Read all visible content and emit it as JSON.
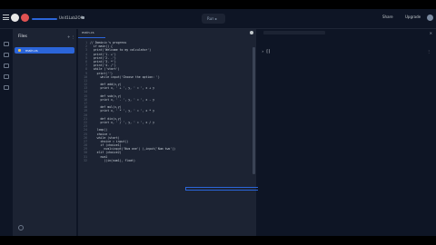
{
  "topbar": {
    "repl_name": "Unit1Lab2OK",
    "run_label": "Run ▸",
    "share_label": "Share",
    "upgrade_label": "Upgrade"
  },
  "files": {
    "title": "Files",
    "actions": "+ ⋮",
    "active_file": "main.cs"
  },
  "editor": {
    "tab_label": "main.cs",
    "lines": [
      {
        "n": "1",
        "text": "// Dominic's progress"
      },
      {
        "n": "2",
        "text": "  if main() {"
      },
      {
        "n": "3",
        "text": "  print('Welcome to my calculator')"
      },
      {
        "n": "4",
        "text": "  print('1. +')"
      },
      {
        "n": "5",
        "text": "  print('2. -')"
      },
      {
        "n": "6",
        "text": "  print('3. *')"
      },
      {
        "n": "7",
        "text": "  print('4. /')"
      },
      {
        "n": "8",
        "text": "  while ('start')"
      },
      {
        "n": "9",
        "text": "    print('')"
      },
      {
        "n": "10",
        "text": "      while input('Choose the option: ')"
      },
      {
        "n": "11",
        "text": ""
      },
      {
        "n": "12",
        "text": "      def add(x,y)"
      },
      {
        "n": "13",
        "text": "      print x, ' + ', y, ' = ', x + y"
      },
      {
        "n": "14",
        "text": ""
      },
      {
        "n": "15",
        "text": "      def sub(x,y)"
      },
      {
        "n": "16",
        "text": "      print x, ' - ', y, ' = ', x - y"
      },
      {
        "n": "17",
        "text": ""
      },
      {
        "n": "18",
        "text": "      def mul(x,y)"
      },
      {
        "n": "19",
        "text": "      print x, ' * ', y, ' = ', x * y"
      },
      {
        "n": "20",
        "text": ""
      },
      {
        "n": "21",
        "text": "      def div(x,y)"
      },
      {
        "n": "22",
        "text": "      print x, ' / ', y, ' = ', x / y"
      },
      {
        "n": "23",
        "text": ""
      },
      {
        "n": "24",
        "text": "    loop()"
      },
      {
        "n": "25",
        "text": "    choice ="
      },
      {
        "n": "26",
        "text": "    while (start)"
      },
      {
        "n": "27",
        "text": "      choice = input()"
      },
      {
        "n": "28",
        "text": "      if (choice1)"
      },
      {
        "n": "29",
        "text": "        num1=input('Num one') (,input('Num two'))"
      },
      {
        "n": "30",
        "text": "    elif (choice2)"
      },
      {
        "n": "31",
        "text": "      num1"
      },
      {
        "n": "32",
        "text": "        ((in(num1), float)"
      }
    ]
  },
  "console": {
    "url": "https://unit1lab2ok.repl.co",
    "close": "✕",
    "clear": "⋮",
    "prompt": "› []"
  },
  "icons": [
    "menu-icon",
    "replit-logo",
    "lock-icon",
    "folder-icon",
    "settings-icon",
    "help-icon"
  ],
  "colors": {
    "accent": "#2b65d9",
    "bg": "#0e1525",
    "panel": "#1c2333"
  }
}
